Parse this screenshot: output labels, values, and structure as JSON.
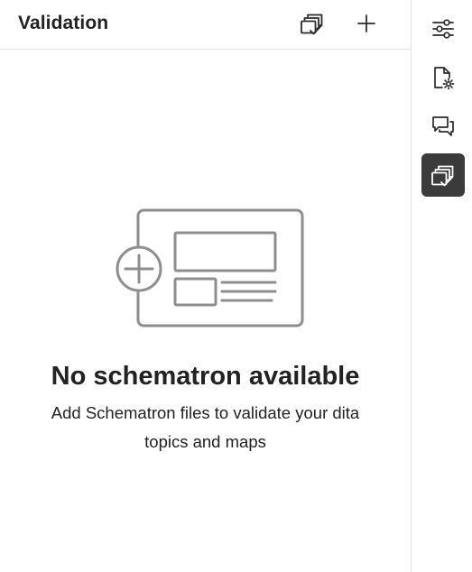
{
  "panel": {
    "title": "Validation",
    "header_actions": {
      "validate_icon": "validate-icon",
      "add_icon": "plus-icon"
    }
  },
  "empty_state": {
    "title": "No schematron available",
    "description": "Add Schematron files to validate your dita topics and maps",
    "illustration_icon": "add-schematron-illustration"
  },
  "rail": {
    "items": [
      {
        "icon": "sliders-icon",
        "active": false
      },
      {
        "icon": "file-settings-icon",
        "active": false
      },
      {
        "icon": "comments-icon",
        "active": false
      },
      {
        "icon": "validate-icon",
        "active": true
      }
    ]
  },
  "colors": {
    "text": "#222222",
    "border": "#e1e1e1",
    "illustration": "#8e8e8e",
    "active_rail_bg": "#3b3b3b",
    "active_rail_icon": "#ffffff"
  }
}
